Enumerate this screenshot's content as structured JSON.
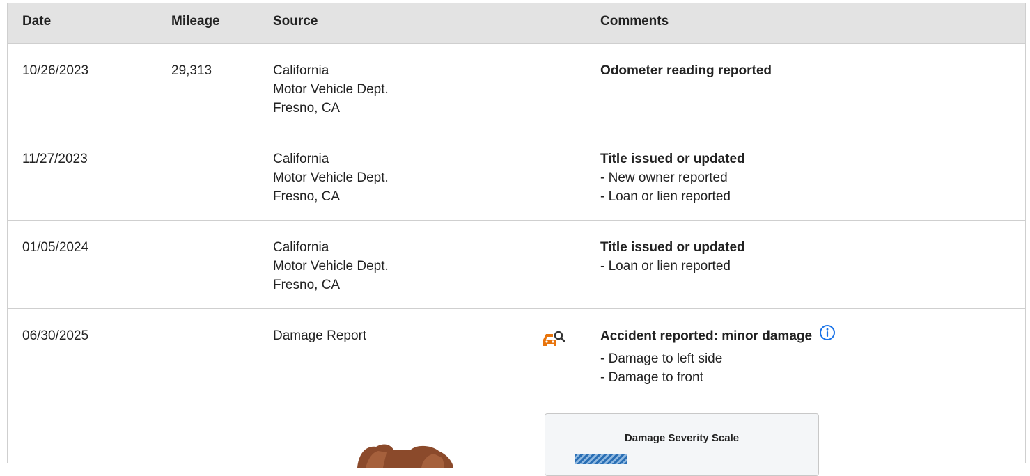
{
  "header": {
    "date": "Date",
    "mileage": "Mileage",
    "source": "Source",
    "comments": "Comments"
  },
  "rows": [
    {
      "date": "10/26/2023",
      "mileage": "29,313",
      "source": [
        "California",
        "Motor Vehicle Dept.",
        "Fresno, CA"
      ],
      "comment_title": "Odometer reading reported",
      "comment_lines": []
    },
    {
      "date": "11/27/2023",
      "mileage": "",
      "source": [
        "California",
        "Motor Vehicle Dept.",
        "Fresno, CA"
      ],
      "comment_title": "Title issued or updated",
      "comment_lines": [
        "- New owner reported",
        "- Loan or lien reported"
      ]
    },
    {
      "date": "01/05/2024",
      "mileage": "",
      "source": [
        "California",
        "Motor Vehicle Dept.",
        "Fresno, CA"
      ],
      "comment_title": "Title issued or updated",
      "comment_lines": [
        "- Loan or lien reported"
      ]
    },
    {
      "date": "06/30/2025",
      "mileage": "",
      "source": [
        "Damage Report"
      ],
      "comment_title": "Accident reported: minor damage",
      "comment_lines": [
        "- Damage to left side",
        "- Damage to front"
      ],
      "icon": "car-damage-search-icon",
      "info_icon": "info-circle-icon"
    }
  ],
  "severity": {
    "title": "Damage Severity Scale"
  },
  "colors": {
    "header_bg": "#e3e3e3",
    "accent_orange": "#e8740c",
    "info_blue": "#1a73e8",
    "severity_blue": "#2a6fb5"
  }
}
